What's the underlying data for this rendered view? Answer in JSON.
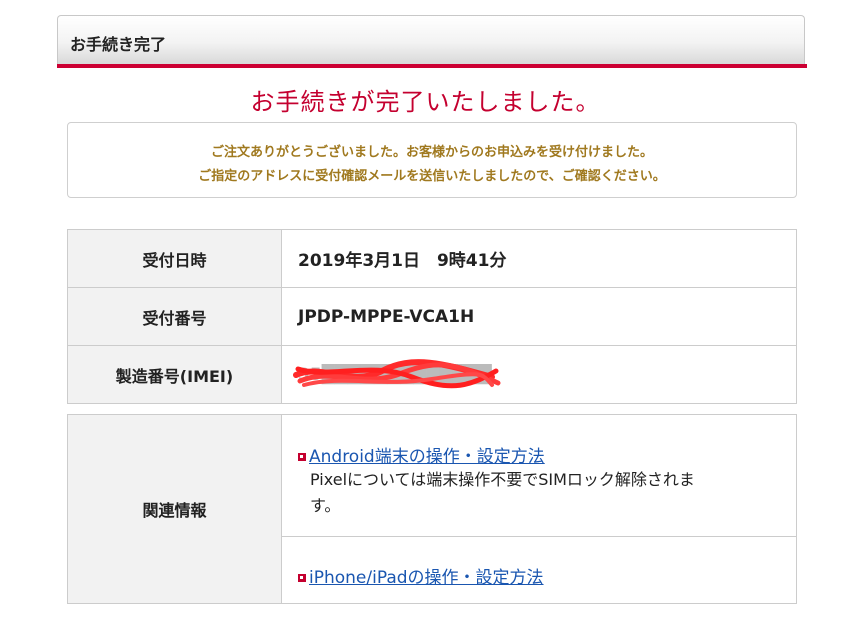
{
  "section": {
    "title": "お手続き完了"
  },
  "complete_heading": "お手続きが完了いたしました。",
  "notice": {
    "line1": "ご注文ありがとうございました。お客様からのお申込みを受け付けました。",
    "line2": "ご指定のアドレスに受付確認メールを送信いたしましたので、ご確認ください。"
  },
  "info_table": {
    "rows": [
      {
        "label": "受付日時",
        "value": "2019年3月1日　9時41分"
      },
      {
        "label": "受付番号",
        "value": "JPDP-MPPE-VCA1H"
      },
      {
        "label": "製造番号(IMEI)",
        "value": "35█████████████"
      }
    ]
  },
  "related": {
    "label": "関連情報",
    "link1": "Android端末の操作・設定方法",
    "desc1_line1": "Pixelについては端末操作不要でSIMロック解除されま",
    "desc1_line2": "す。",
    "link2": "iPhone/iPadの操作・設定方法"
  },
  "colors": {
    "accent_red": "#c4002f",
    "notice_text": "#a0791f",
    "link_blue": "#1a56b0"
  }
}
